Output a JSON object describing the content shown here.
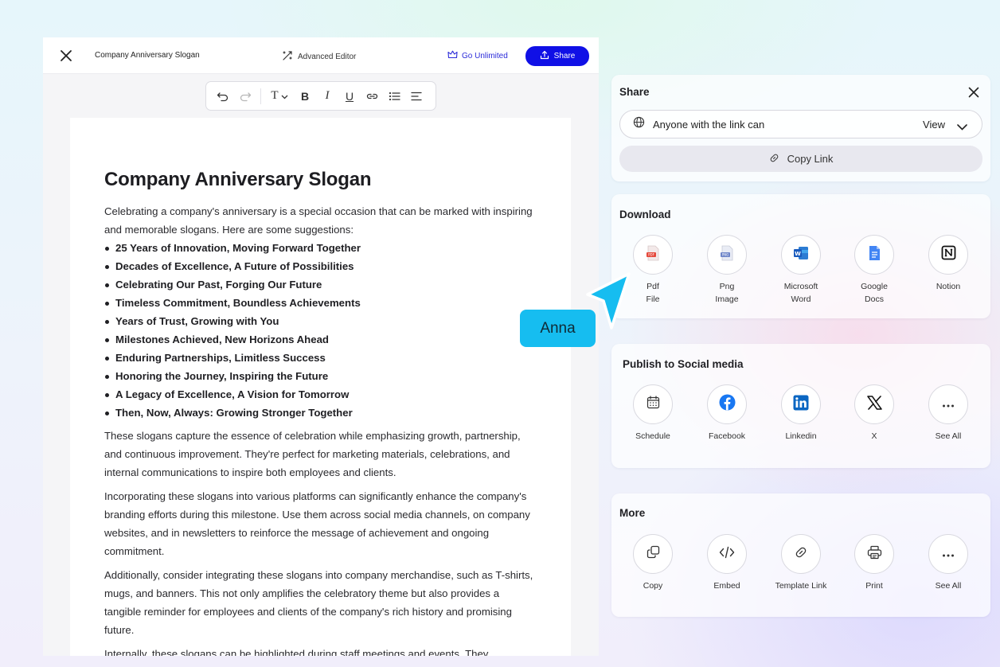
{
  "editor": {
    "header": {
      "title": "Company Anniversary Slogan",
      "advanced_editor": "Advanced Editor",
      "go_unlimited": "Go Unlimited",
      "share": "Share"
    },
    "toolbar": {
      "text_style": "T",
      "bold": "B",
      "italic": "I",
      "underline": "U"
    },
    "document": {
      "heading": "Company Anniversary Slogan",
      "intro": "Celebrating a company's anniversary is a special occasion that can be marked with inspiring and memorable slogans. Here are some suggestions:",
      "slogans": [
        "25 Years of Innovation, Moving Forward Together",
        "Decades of Excellence, A Future of Possibilities",
        "Celebrating Our Past, Forging Our Future",
        "Timeless Commitment, Boundless Achievements",
        "Years of Trust, Growing with You",
        "Milestones Achieved, New Horizons Ahead",
        "Enduring Partnerships, Limitless Success",
        "Honoring the Journey, Inspiring the Future",
        "A Legacy of Excellence, A Vision for Tomorrow",
        "Then, Now, Always: Growing Stronger Together"
      ],
      "paragraphs": [
        "These slogans capture the essence of celebration while emphasizing growth, partnership, and continuous improvement. They're perfect for marketing materials, celebrations, and internal communications to inspire both employees and clients.",
        "Incorporating these slogans into various platforms can significantly enhance the company's branding efforts during this milestone. Use them across social media channels, on company websites, and in newsletters to reinforce the message of achievement and ongoing commitment.",
        "Additionally, consider integrating these slogans into company merchandise, such as T-shirts, mugs, and banners. This not only amplifies the celebratory theme but also provides a tangible reminder for employees and clients of the company's rich history and promising future.",
        "Internally, these slogans can be highlighted during staff meetings and events. They"
      ]
    }
  },
  "share_panel": {
    "title": "Share",
    "access": "Anyone with the link can",
    "permission": "View",
    "copy_link": "Copy Link"
  },
  "download_panel": {
    "title": "Download",
    "options": [
      {
        "label": "Pdf\nFile",
        "icon": "pdf-file-icon"
      },
      {
        "label": "Png\nImage",
        "icon": "png-image-icon"
      },
      {
        "label": "Microsoft\nWord",
        "icon": "microsoft-word-icon"
      },
      {
        "label": "Google\nDocs",
        "icon": "google-docs-icon"
      },
      {
        "label": "Notion",
        "icon": "notion-icon"
      }
    ]
  },
  "social_panel": {
    "title": "Publish to Social media",
    "options": [
      {
        "label": "Schedule",
        "icon": "calendar-icon"
      },
      {
        "label": "Facebook",
        "icon": "facebook-icon"
      },
      {
        "label": "Linkedin",
        "icon": "linkedin-icon"
      },
      {
        "label": "X",
        "icon": "x-icon"
      },
      {
        "label": "See All",
        "icon": "more-dots-icon"
      }
    ]
  },
  "more_panel": {
    "title": "More",
    "options": [
      {
        "label": "Copy",
        "icon": "copy-icon"
      },
      {
        "label": "Embed",
        "icon": "code-icon"
      },
      {
        "label": "Template Link",
        "icon": "link-icon"
      },
      {
        "label": "Print",
        "icon": "printer-icon"
      },
      {
        "label": "See All",
        "icon": "more-dots-icon"
      }
    ]
  },
  "collaborator": {
    "name": "Anna",
    "color": "#16bdf0"
  },
  "colors": {
    "primary": "#1010e6",
    "facebook": "#1877f2",
    "linkedin": "#0a66c2",
    "word": "#185abd",
    "docs": "#4285f4",
    "pdf": "#e5483b"
  }
}
